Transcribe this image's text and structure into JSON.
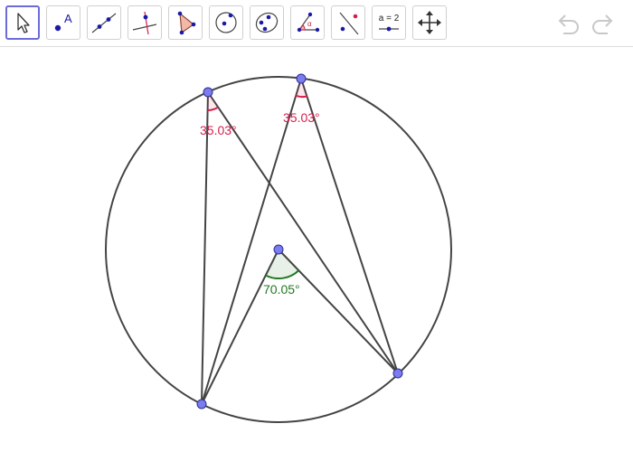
{
  "toolbar": {
    "tools": [
      {
        "id": "move",
        "icon": "move-arrow-icon",
        "selected": true
      },
      {
        "id": "point",
        "icon": "point-icon",
        "text": "A"
      },
      {
        "id": "line",
        "icon": "line-icon"
      },
      {
        "id": "perpendicular",
        "icon": "perpendicular-line-icon"
      },
      {
        "id": "polygon",
        "icon": "polygon-icon"
      },
      {
        "id": "circle",
        "icon": "circle-icon"
      },
      {
        "id": "conic",
        "icon": "ellipse-icon"
      },
      {
        "id": "angle",
        "icon": "angle-icon",
        "text": "α"
      },
      {
        "id": "reflect",
        "icon": "reflect-icon"
      },
      {
        "id": "slider",
        "icon": "slider-icon",
        "text": "a = 2"
      },
      {
        "id": "move-view",
        "icon": "move-graphics-view-icon"
      }
    ],
    "undo_icon": "undo-icon",
    "redo_icon": "redo-icon"
  },
  "geometry": {
    "angles": {
      "left_inscribed": "35.03°",
      "top_inscribed": "35.03°",
      "central": "70.05°"
    },
    "colors": {
      "circle": "#444444",
      "point_fill": "#7a7cf0",
      "point_stroke": "#2f2f8f",
      "inscribed_angle": "#d41e4e",
      "central_angle": "#1f7a1f",
      "selected_tool_border": "#6b6bdc"
    }
  }
}
